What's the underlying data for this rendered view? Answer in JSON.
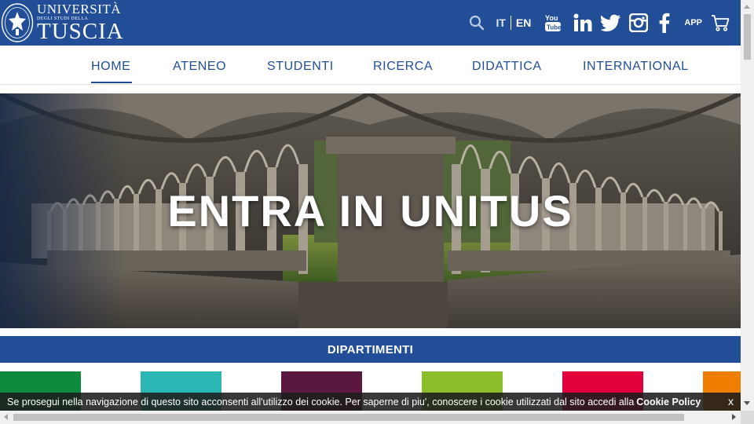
{
  "brand": {
    "line1": "UNIVERSITÀ",
    "line2": "DEGLI STUDI DELLA",
    "line3": "TUSCIA"
  },
  "top_actions": {
    "lang_it": "IT",
    "lang_en": "EN",
    "app": "APP"
  },
  "nav": {
    "items": [
      "HOME",
      "ATENEO",
      "STUDENTI",
      "RICERCA",
      "DIDATTICA",
      "INTERNATIONAL"
    ]
  },
  "hero": {
    "title": "ENTRA IN UNITUS"
  },
  "departments": {
    "title": "DIPARTIMENTI",
    "tile_colors": [
      "#0e8a3c",
      "#2bb8b5",
      "#5a1840",
      "#8cbd2a",
      "#e2003c",
      "#ef7d00"
    ]
  },
  "cookie": {
    "text": "Se prosegui nella navigazione di questo sito acconsenti all'utilizzo dei cookie. Per saperne di piu', conoscere i cookie utilizzati dal sito accedi alla",
    "link": "Cookie Policy",
    "close": "x"
  },
  "colors": {
    "primary": "#214e96"
  }
}
